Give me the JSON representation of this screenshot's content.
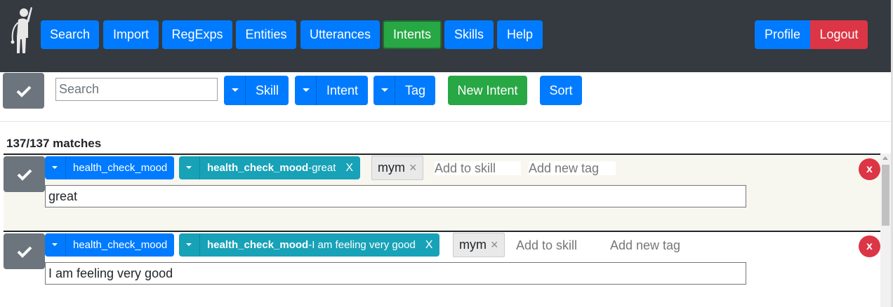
{
  "nav": {
    "items": [
      {
        "label": "Search"
      },
      {
        "label": "Import"
      },
      {
        "label": "RegExps"
      },
      {
        "label": "Entities"
      },
      {
        "label": "Utterances"
      },
      {
        "label": "Intents",
        "active": true
      },
      {
        "label": "Skills"
      },
      {
        "label": "Help"
      }
    ],
    "profile_label": "Profile",
    "logout_label": "Logout"
  },
  "toolbar": {
    "search_placeholder": "Search",
    "skill_label": "Skill",
    "intent_label": "Intent",
    "tag_label": "Tag",
    "new_intent_label": "New Intent",
    "sort_label": "Sort"
  },
  "matches_text": "137/137 matches",
  "items": [
    {
      "skill": "health_check_mood",
      "intent_bold": "health_check_mood",
      "intent_rest": "-great",
      "remove": "X",
      "tag": "mym",
      "tag_remove": "×",
      "add_skill_placeholder": "Add to skill",
      "add_tag_placeholder": "Add new tag",
      "text": "great",
      "delete": "x"
    },
    {
      "skill": "health_check_mood",
      "intent_bold": "health_check_mood",
      "intent_rest": "-I am feeling very good",
      "remove": "X",
      "tag": "mym",
      "tag_remove": "×",
      "add_skill_placeholder": "Add to skill",
      "add_tag_placeholder": "Add new tag",
      "text": "I am feeling very good",
      "delete": "x"
    }
  ],
  "colors": {
    "navbar": "#343a40",
    "primary": "#007bff",
    "success": "#28a745",
    "danger": "#dc3545",
    "info": "#17a2b8",
    "secondary": "#6c757d"
  }
}
